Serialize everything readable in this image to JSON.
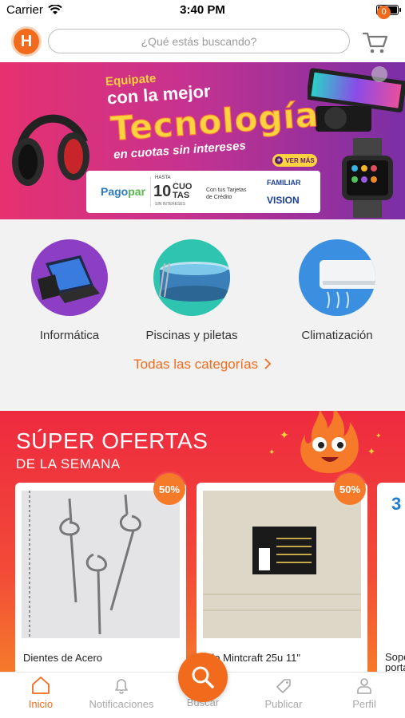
{
  "status_bar": {
    "carrier": "Carrier",
    "time": "3:40 PM"
  },
  "header": {
    "logo_letter": "H",
    "search_placeholder": "¿Qué estás buscando?",
    "cart_count": "0"
  },
  "banner": {
    "line1": "Equipate",
    "line2": "con la mejor",
    "line3": "Tecnología",
    "line4": "en cuotas sin intereses",
    "cta": "VER MÁS",
    "pago": "Pago",
    "par": "par",
    "hasta": "HASTA",
    "cuotas_num": "10",
    "cuotas_word_1": "CUO",
    "cuotas_word_2": "TAS",
    "sin_intereses": "SIN INTERESES",
    "tarjetas_1": "Con tus Tarjetas",
    "tarjetas_2": "de Crédito",
    "familiar": "FAMILIAR",
    "vision": "VISION"
  },
  "categories": {
    "items": [
      {
        "label": "Informática"
      },
      {
        "label": "Piscinas y piletas"
      },
      {
        "label": "Climatización"
      }
    ],
    "all_link": "Todas las categorías"
  },
  "offers": {
    "title": "SÚPER OFERTAS",
    "subtitle": "DE LA SEMANA",
    "products": [
      {
        "name": "Dientes de Acero",
        "discount": "50%"
      },
      {
        "name": "tillo Mintcraft 25u 11\"",
        "discount": "50%"
      },
      {
        "name": "Sopo",
        "name_2": "porta",
        "preview": "3"
      }
    ]
  },
  "tabbar": {
    "items": [
      {
        "label": "Inicio"
      },
      {
        "label": "Notificaciones"
      },
      {
        "label": "Buscar"
      },
      {
        "label": "Publicar"
      },
      {
        "label": "Perfil"
      }
    ]
  },
  "colors": {
    "brand": "#f26b1d",
    "offers_red": "#ee2a3f"
  }
}
